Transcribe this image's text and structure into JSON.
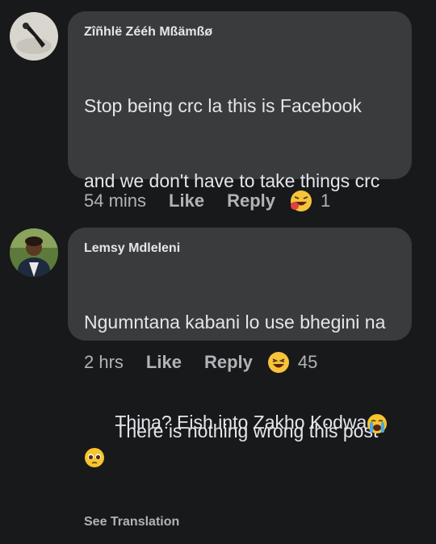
{
  "comments": [
    {
      "author": "Zîñhlë Zééh Mßämßø",
      "line1": "Stop being crc la this is Facebook",
      "line2": "and we don't have to take things crc",
      "line3": "There is nothing wrong this post",
      "time": "54 mins",
      "like_label": "Like",
      "reply_label": "Reply",
      "reaction_icon": "haha-angry-reaction",
      "reaction_count": "1"
    },
    {
      "author": "Lemsy Mdleleni",
      "line1": "Ngumntana kabani lo use bhegini na",
      "line2": "Thina? Eish into Zakho Kodwa",
      "see_translation": "See Translation",
      "time": "2 hrs",
      "like_label": "Like",
      "reply_label": "Reply",
      "reaction_icon": "haha-reaction",
      "reaction_count": "45"
    }
  ]
}
